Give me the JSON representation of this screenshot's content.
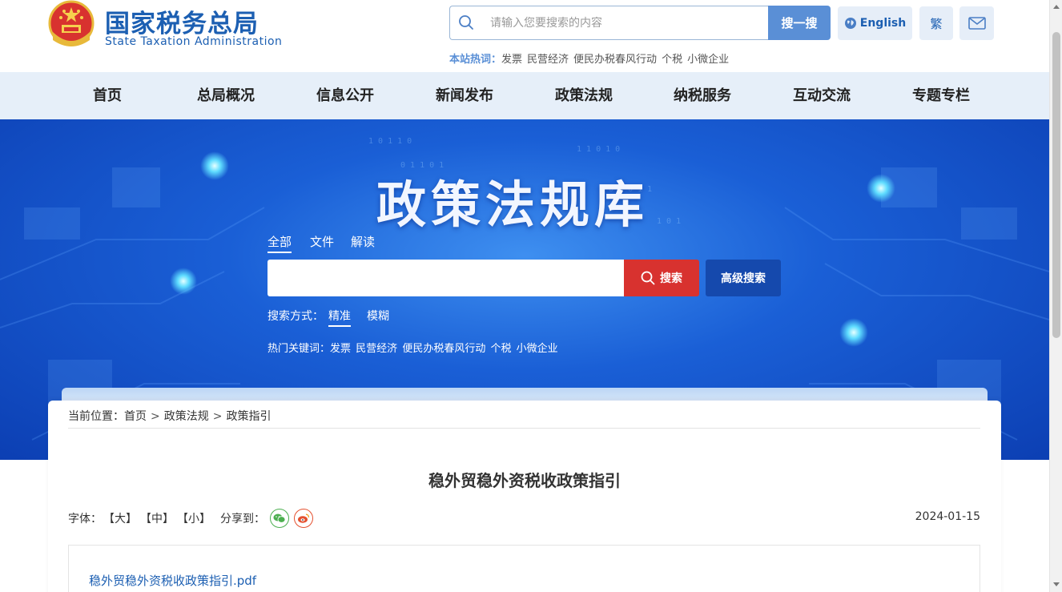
{
  "header": {
    "logo_cn": "国家税务总局",
    "logo_en": "State Taxation Administration",
    "search_placeholder": "请输入您要搜索的内容",
    "search_button": "搜一搜",
    "english_button": "English",
    "traditional_button": "繁",
    "hotwords_label": "本站热词：",
    "hotwords": [
      "发票",
      "民营经济",
      "便民办税春风行动",
      "个税",
      "小微企业"
    ]
  },
  "nav": {
    "items": [
      "首页",
      "总局概况",
      "信息公开",
      "新闻发布",
      "政策法规",
      "纳税服务",
      "互动交流",
      "专题专栏"
    ]
  },
  "banner": {
    "title": "政策法规库",
    "tabs": [
      "全部",
      "文件",
      "解读"
    ],
    "active_tab": "全部",
    "search_value": "",
    "search_button": "搜索",
    "advanced_button": "高级搜索",
    "mode_label": "搜索方式：",
    "modes": [
      "精准",
      "模糊"
    ],
    "active_mode": "精准",
    "keywords_label": "热门关键词：",
    "keywords": [
      "发票",
      "民营经济",
      "便民办税春风行动",
      "个税",
      "小微企业"
    ]
  },
  "content": {
    "breadcrumb_label": "当前位置：",
    "breadcrumb": [
      "首页",
      "政策法规",
      "政策指引"
    ],
    "breadcrumb_sep": ">",
    "title": "稳外贸稳外资税收政策指引",
    "font_label": "字体：",
    "font_options": [
      "【大】",
      "【中】",
      "【小】"
    ],
    "share_label": "分享到：",
    "date": "2024-01-15",
    "attachment": "稳外贸稳外资税收政策指引.pdf"
  },
  "colors": {
    "brand_blue": "#1c5fb2",
    "search_red": "#d8322f",
    "advanced_blue": "#1549ad",
    "nav_bg": "#e6eff9"
  }
}
